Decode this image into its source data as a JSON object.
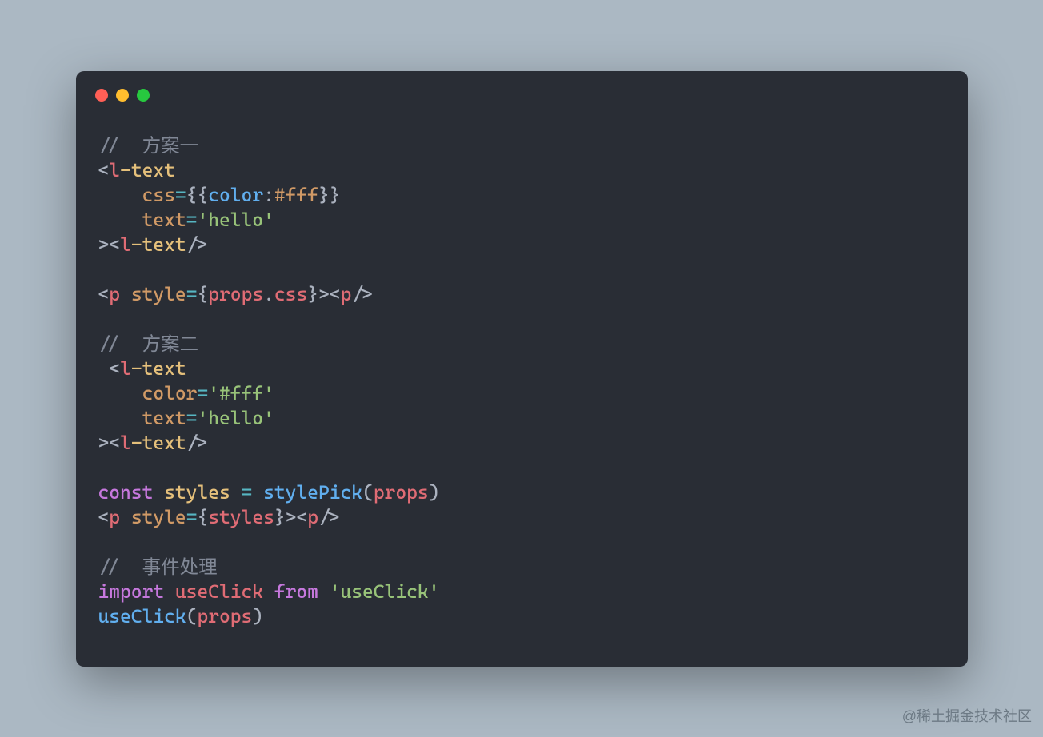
{
  "watermark": "@稀土掘金技术社区",
  "code": {
    "comment1_slashes": "//  ",
    "comment1_text": "方案一",
    "lt": "<",
    "gt": ">",
    "slash": "/",
    "eq": "=",
    "lb": "{",
    "rb": "}",
    "lp": "(",
    "rp": ")",
    "colon": ":",
    "dot": ".",
    "sq": "'",
    "tag_l": "l",
    "tag_text": "-text",
    "tag_p": "p",
    "attr_css": "css",
    "attr_text": "text",
    "attr_style": "style",
    "attr_color": "color",
    "val_color": "color",
    "val_fff": "#fff",
    "str_hello": "hello",
    "str_fff": "#fff",
    "str_useClick": "useClick",
    "id_props": "props",
    "id_styles": "styles",
    "id_stylePick": "stylePick",
    "id_useClick": "useClick",
    "kw_const": "const",
    "kw_import": "import",
    "kw_from": "from",
    "comment2_slashes": "//  ",
    "comment2_text": "方案二",
    "comment3_slashes": "//  ",
    "comment3_text": "事件处理",
    "indent4": "    ",
    "indent1": " "
  }
}
